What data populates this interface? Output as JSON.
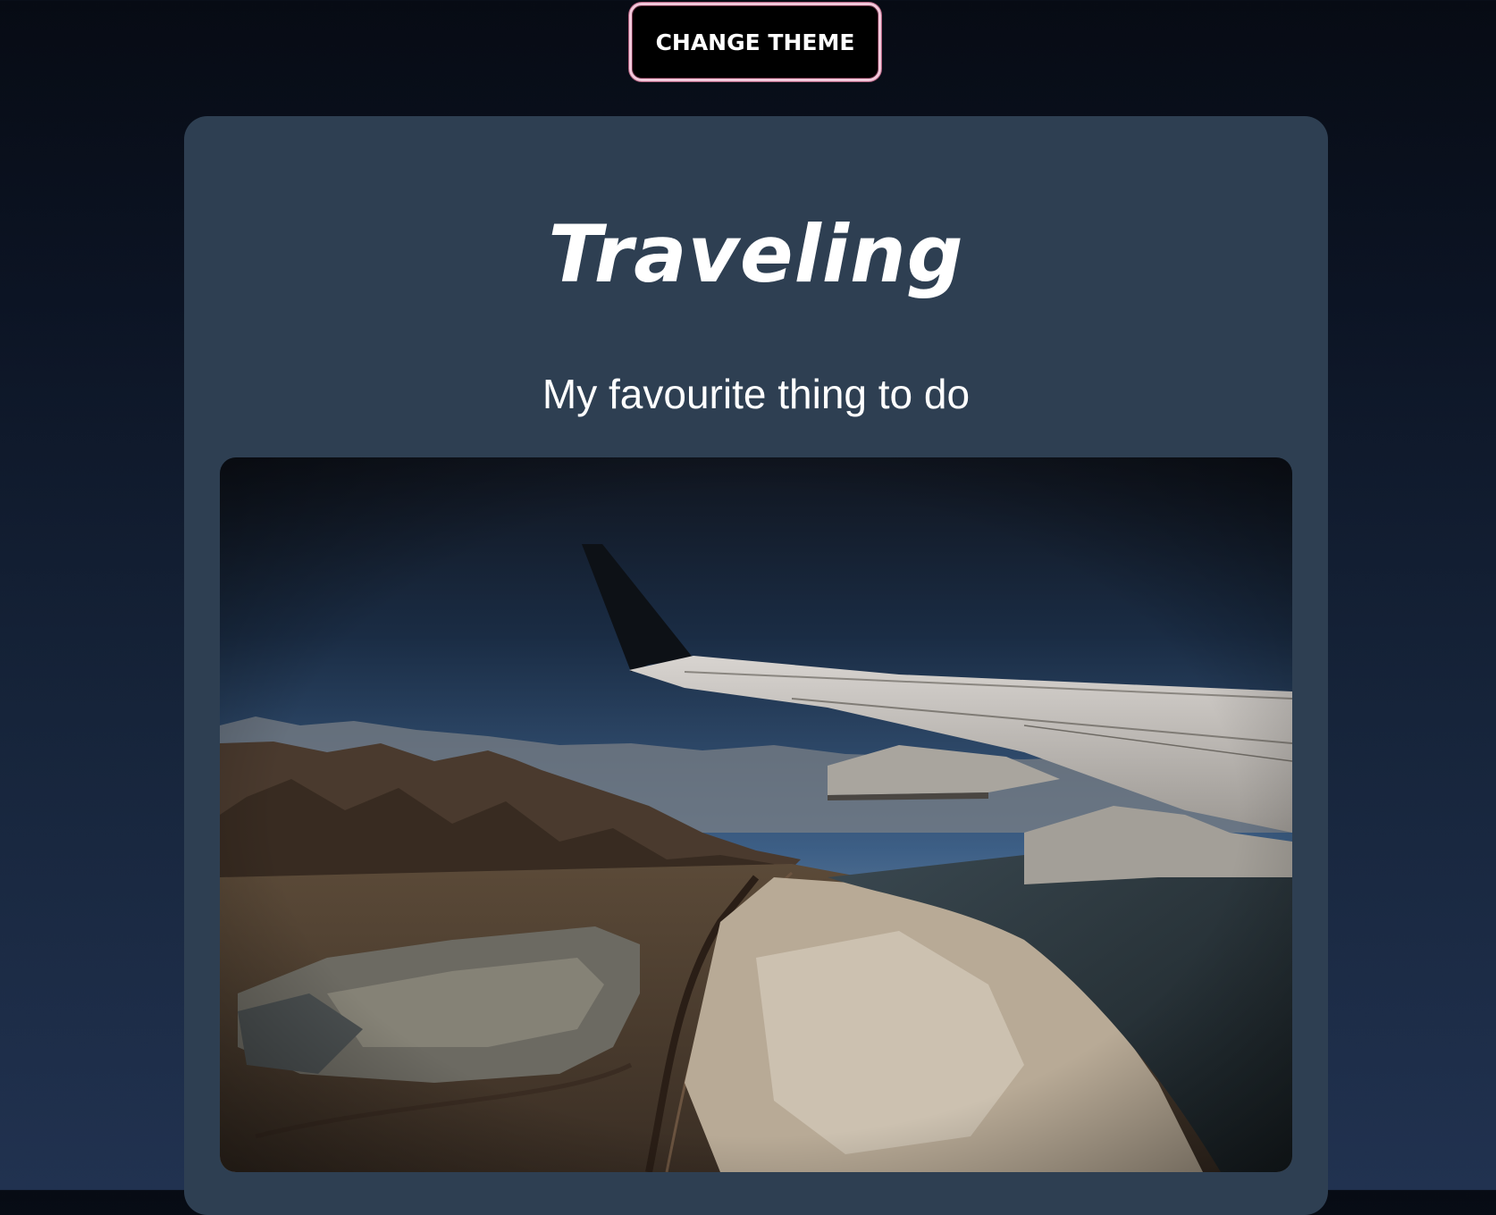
{
  "theme_button": {
    "label": "CHANGE THEME"
  },
  "card": {
    "title": "Traveling",
    "subtitle": "My favourite thing to do",
    "image": {
      "icon": "airplane-wing-photo"
    }
  },
  "colors": {
    "background_top": "#070b14",
    "background_bottom": "#213250",
    "card": "#2e3f52",
    "button_bg": "#000000",
    "button_border": "#f3c8db",
    "text": "#ffffff"
  }
}
